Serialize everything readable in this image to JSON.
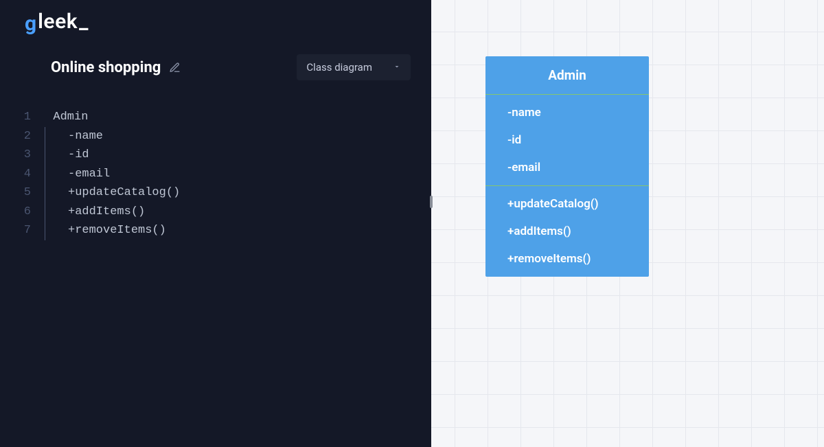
{
  "app": {
    "logo_g": "g",
    "logo_text": "leek",
    "logo_cursor": "_"
  },
  "header": {
    "doc_title": "Online shopping",
    "diagram_type": "Class diagram"
  },
  "editor": {
    "lines": [
      "Admin",
      "-name",
      "-id",
      "-email",
      "+updateCatalog()",
      "+addItems()",
      "+removeItems()"
    ],
    "line_numbers": [
      "1",
      "2",
      "3",
      "4",
      "5",
      "6",
      "7"
    ]
  },
  "diagram": {
    "class_name": "Admin",
    "attributes": [
      "-name",
      "-id",
      "-email"
    ],
    "methods": [
      "+updateCatalog()",
      "+addItems()",
      "+removeItems()"
    ]
  }
}
